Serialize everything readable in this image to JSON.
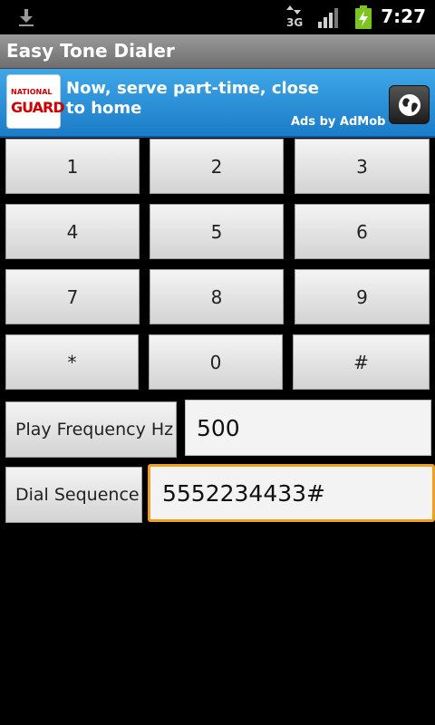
{
  "status_bar": {
    "time": "7:27",
    "network_label": "3G",
    "icons": [
      "download-icon",
      "network-3g-icon",
      "signal-icon",
      "battery-charging-icon"
    ]
  },
  "app": {
    "title": "Easy Tone Dialer"
  },
  "ad": {
    "logo_top": "NATIONAL",
    "logo_main": "GUARD",
    "text": "Now, serve part-time, close to home",
    "attribution": "Ads by AdMob",
    "icon": "globe-icon"
  },
  "keypad": {
    "keys": [
      "1",
      "2",
      "3",
      "4",
      "5",
      "6",
      "7",
      "8",
      "9",
      "*",
      "0",
      "#"
    ]
  },
  "frequency": {
    "button_label": "Play Frequency Hz",
    "value": "500"
  },
  "dial": {
    "button_label": "Dial Sequence",
    "value": "5552234433#"
  },
  "colors": {
    "ad_background": "#2a8fd8",
    "focus_border": "#f0a020",
    "battery": "#7cc520"
  }
}
